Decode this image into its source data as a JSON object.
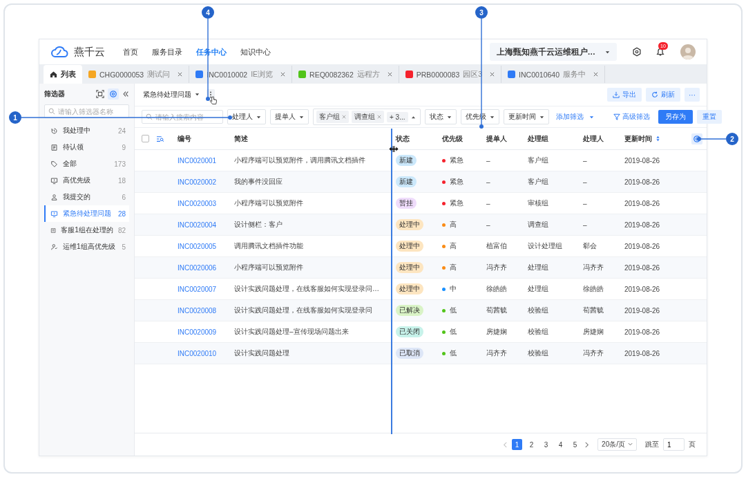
{
  "nav": {
    "logo": "燕千云",
    "items": [
      {
        "label": "首页",
        "selected": false
      },
      {
        "label": "服务目录",
        "selected": false
      },
      {
        "label": "任务中心",
        "selected": true
      },
      {
        "label": "知识中心",
        "selected": false
      }
    ],
    "tenant": "上海甄知燕千云运维租户…",
    "notifications": "10"
  },
  "tabs": [
    {
      "kind": "home",
      "label": "列表",
      "selected": true
    },
    {
      "kind": "record",
      "code": "CHG0000053",
      "title": "测试问",
      "color": "#f5a623",
      "selected": false
    },
    {
      "kind": "record",
      "code": "INC0010002",
      "title": "IE浏览",
      "color": "#2f7bf6",
      "selected": false
    },
    {
      "kind": "record",
      "code": "REQ0082362",
      "title": "远程方",
      "color": "#52c41a",
      "selected": false
    },
    {
      "kind": "record",
      "code": "PRB0000083",
      "title": "园区3",
      "color": "#f5222d",
      "selected": false
    },
    {
      "kind": "record",
      "code": "INC0010640",
      "title": "服务中",
      "color": "#2f7bf6",
      "selected": false
    }
  ],
  "sidebar": {
    "title": "筛选器",
    "search_placeholder": "请输入筛选器名称",
    "items": [
      {
        "label": "我处理中",
        "count": "24",
        "selected": false
      },
      {
        "label": "待认领",
        "count": "9",
        "selected": false
      },
      {
        "label": "全部",
        "count": "173",
        "selected": false
      },
      {
        "label": "高优先级",
        "count": "18",
        "selected": false
      },
      {
        "label": "我提交的",
        "count": "6",
        "selected": false
      },
      {
        "label": "紧急待处理问题",
        "count": "28",
        "selected": true
      },
      {
        "label": "客服1组在处理的",
        "count": "82",
        "selected": false
      },
      {
        "label": "运维1组高优先级",
        "count": "5",
        "selected": false
      }
    ]
  },
  "toolbar": {
    "view": "紧急待处理问题",
    "actions": [
      {
        "kind": "export",
        "label": "导出"
      },
      {
        "kind": "refresh",
        "label": "刷新"
      }
    ],
    "more": "···"
  },
  "filters": {
    "search_placeholder": "请输入搜索内容",
    "items": [
      {
        "kind": "dropdown",
        "label": "处理人"
      },
      {
        "kind": "dropdown",
        "label": "提单人"
      },
      {
        "kind": "tags",
        "tags": [
          "客户组",
          "调查组"
        ],
        "more": "+ 3..."
      },
      {
        "kind": "dropdown",
        "label": "状态"
      },
      {
        "kind": "dropdown",
        "label": "优先级"
      },
      {
        "kind": "dropdown",
        "label": "更新时间"
      }
    ],
    "add_filter": "添加筛选",
    "advanced": "高级筛选",
    "save_as": "另存为",
    "reset": "重置"
  },
  "table": {
    "select_all": false,
    "columns": [
      {
        "label": "编号",
        "sortable": false
      },
      {
        "label": "简述",
        "sortable": false
      },
      {
        "label": "状态",
        "sortable": false
      },
      {
        "label": "优先级",
        "sortable": false
      },
      {
        "label": "提单人",
        "sortable": false
      },
      {
        "label": "处理组",
        "sortable": false
      },
      {
        "label": "处理人",
        "sortable": false
      },
      {
        "label": "更新时间",
        "sortable": true
      }
    ],
    "rows": [
      {
        "id": "INC0020001",
        "summary": "小程序端可以预览附件，调用腾讯文档插件",
        "status": {
          "label": "新建",
          "color": "#cbe8fb"
        },
        "priority": {
          "label": "紧急",
          "color": "#f5222d"
        },
        "submitter": "–",
        "group": "客户组",
        "assignee": "–",
        "updated": "2019-08-26"
      },
      {
        "id": "INC0020002",
        "summary": "我的事件没回应",
        "status": {
          "label": "新建",
          "color": "#cbe8fb"
        },
        "priority": {
          "label": "紧急",
          "color": "#f5222d"
        },
        "submitter": "–",
        "group": "客户组",
        "assignee": "–",
        "updated": "2019-08-26"
      },
      {
        "id": "INC0020003",
        "summary": "小程序端可以预览附件",
        "status": {
          "label": "暂挂",
          "color": "#efdcfb"
        },
        "priority": {
          "label": "紧急",
          "color": "#f5222d"
        },
        "submitter": "–",
        "group": "审核组",
        "assignee": "–",
        "updated": "2019-08-26"
      },
      {
        "id": "INC0020004",
        "summary": "设计侧栏：客户",
        "status": {
          "label": "处理中",
          "color": "#fde5c0"
        },
        "priority": {
          "label": "高",
          "color": "#fa8c16"
        },
        "submitter": "–",
        "group": "调查组",
        "assignee": "–",
        "updated": "2019-08-26"
      },
      {
        "id": "INC0020005",
        "summary": "调用腾讯文档插件功能",
        "status": {
          "label": "处理中",
          "color": "#fde5c0"
        },
        "priority": {
          "label": "高",
          "color": "#fa8c16"
        },
        "submitter": "植富伯",
        "group": "设计处理组",
        "assignee": "郗会",
        "updated": "2019-08-26"
      },
      {
        "id": "INC0020006",
        "summary": "小程序端可以预览附件",
        "status": {
          "label": "处理中",
          "color": "#fde5c0"
        },
        "priority": {
          "label": "高",
          "color": "#fa8c16"
        },
        "submitter": "冯齐齐",
        "group": "处理组",
        "assignee": "冯齐齐",
        "updated": "2019-08-26"
      },
      {
        "id": "INC0020007",
        "summary": "设计实践问题处理，在线客服如何实现登录问…",
        "status": {
          "label": "处理中",
          "color": "#fde5c0"
        },
        "priority": {
          "label": "中",
          "color": "#1890ff"
        },
        "submitter": "徐皓皓",
        "group": "处理组",
        "assignee": "徐皓皓",
        "updated": "2019-08-26"
      },
      {
        "id": "INC0020008",
        "summary": "设计实践问题处理，在线客服如何实现登录问",
        "status": {
          "label": "已解决",
          "color": "#d9f3c6"
        },
        "priority": {
          "label": "低",
          "color": "#52c41a"
        },
        "submitter": "荀茜毓",
        "group": "校验组",
        "assignee": "荀茜毓",
        "updated": "2019-08-26"
      },
      {
        "id": "INC0020009",
        "summary": "设计实践问题处理–宣传现场问题出来",
        "status": {
          "label": "已关闭",
          "color": "#c7f2ea"
        },
        "priority": {
          "label": "低",
          "color": "#52c41a"
        },
        "submitter": "房婕娴",
        "group": "校验组",
        "assignee": "房婕娴",
        "updated": "2019-08-26"
      },
      {
        "id": "INC0020010",
        "summary": "设计实践问题处理",
        "status": {
          "label": "已取消",
          "color": "#dde6f7"
        },
        "priority": {
          "label": "低",
          "color": "#52c41a"
        },
        "submitter": "冯齐齐",
        "group": "校验组",
        "assignee": "冯齐齐",
        "updated": "2019-08-26"
      }
    ]
  },
  "pagination": {
    "pages": [
      {
        "label": "1",
        "selected": true
      },
      {
        "label": "2",
        "selected": false
      },
      {
        "label": "3",
        "selected": false
      },
      {
        "label": "4",
        "selected": false
      },
      {
        "label": "5",
        "selected": false
      }
    ],
    "page_size": "20条/页",
    "jump_label": "跳至",
    "jump_value": "1",
    "page_unit": "页"
  },
  "callouts": [
    {
      "label": "1"
    },
    {
      "label": "2"
    },
    {
      "label": "3"
    },
    {
      "label": "4"
    }
  ]
}
